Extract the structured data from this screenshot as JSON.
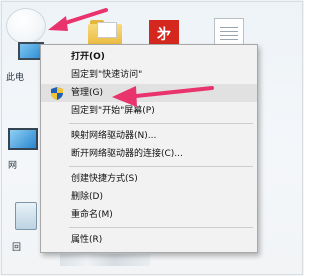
{
  "desktop": {
    "this_pc_label": "此电",
    "network_label": "网",
    "recycle_bin_label": "回",
    "app_tile_text": "㐧"
  },
  "context_menu": {
    "items": [
      {
        "label": "打开(O)",
        "bold": true
      },
      {
        "label": "固定到\"快速访问\""
      },
      {
        "label": "管理(G)",
        "icon": "shield-icon",
        "highlighted": true
      },
      {
        "label": "固定到\"开始\"屏幕(P)"
      },
      {
        "separator": true
      },
      {
        "label": "映射网络驱动器(N)..."
      },
      {
        "label": "断开网络驱动器的连接(C)..."
      },
      {
        "separator": true
      },
      {
        "label": "创建快捷方式(S)"
      },
      {
        "label": "删除(D)"
      },
      {
        "label": "重命名(M)"
      },
      {
        "separator": true
      },
      {
        "label": "属性(R)"
      }
    ]
  },
  "annotations": {
    "arrow_color": "#e8336d"
  },
  "colors": {
    "menu_background": "#f2f2f2",
    "menu_border": "#a8a8a8",
    "highlight": "#e1e1e1"
  }
}
